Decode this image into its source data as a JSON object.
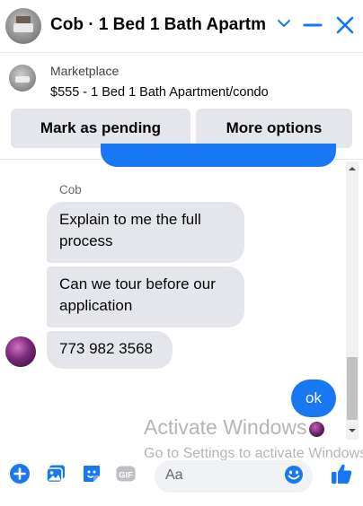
{
  "header": {
    "title": "Cob · 1 Bed 1 Bath Apartm...",
    "icons": [
      "chevron-down-icon",
      "minimize-icon",
      "close-icon"
    ]
  },
  "marketplace": {
    "label": "Marketplace",
    "listing": "$555 - 1 Bed 1 Bath Apartment/condo",
    "buttons": {
      "pending": "Mark as pending",
      "more": "More options"
    }
  },
  "conversation": {
    "sender_name": "Cob",
    "received_messages": [
      "Explain to me the full process",
      "Can we tour before our application",
      "773 982 3568"
    ],
    "sent_message": "ok"
  },
  "watermark": {
    "line1": "Activate Windows",
    "line2": "Go to Settings to activate Windows."
  },
  "composer": {
    "placeholder": "Aa",
    "icons": [
      "plus-icon",
      "photo-icon",
      "sticker-icon",
      "gif-icon",
      "emoji-icon",
      "like-icon"
    ]
  },
  "colors": {
    "accent": "#1877f2",
    "bubble_gray": "#e4e6eb",
    "text": "#050505",
    "muted": "#65676b"
  }
}
